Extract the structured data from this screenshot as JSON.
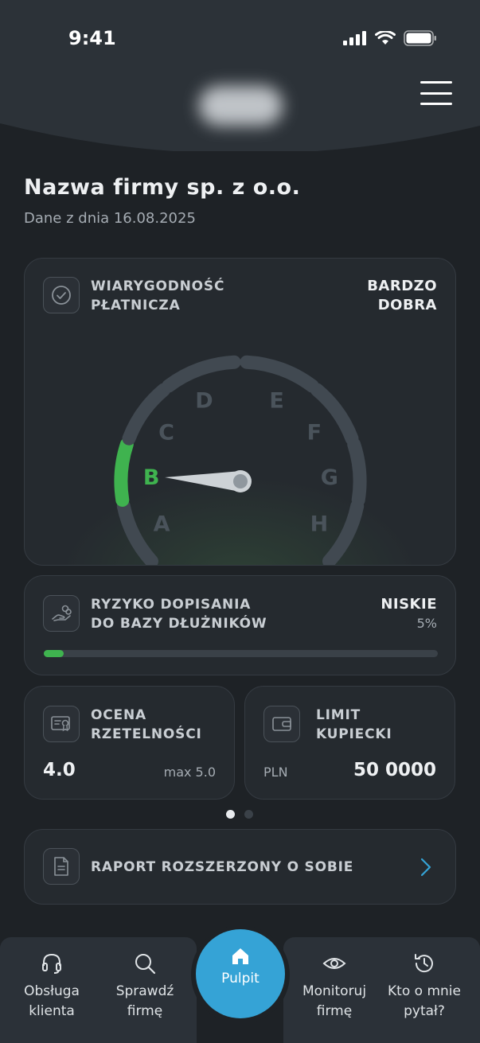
{
  "status_bar": {
    "time": "9:41"
  },
  "header": {
    "menu_icon": "hamburger-menu-icon"
  },
  "company": {
    "name": "Nazwa firmy sp. z o.o.",
    "date_label": "Dane z dnia 16.08.2025"
  },
  "credibility": {
    "title_line1": "WIARYGODNOŚĆ",
    "title_line2": "PŁATNICZA",
    "value_line1": "BARDZO",
    "value_line2": "DOBRA",
    "icon": "check-circle-icon",
    "grades": [
      "A",
      "B",
      "C",
      "D",
      "E",
      "F",
      "G",
      "H"
    ],
    "active_grade": "B",
    "active_color": "#3fb34f"
  },
  "risk": {
    "title_line1": "RYZYKO DOPISANIA",
    "title_line2": "DO BAZY DŁUŻNIKÓW",
    "value": "NISKIE",
    "percent_label": "5%",
    "percent": 5,
    "icon": "hand-coins-icon"
  },
  "rating": {
    "title_line1": "OCENA",
    "title_line2": "RZETELNOŚCI",
    "value": "4.0",
    "max_label": "max 5.0",
    "icon": "certificate-icon"
  },
  "limit": {
    "title_line1": "LIMIT",
    "title_line2": "KUPIECKI",
    "currency": "PLN",
    "value": "50 0000",
    "icon": "wallet-icon"
  },
  "pager": {
    "pages": 2,
    "current": 1
  },
  "report": {
    "label": "RAPORT ROZSZERZONY O SOBIE",
    "icon": "document-icon"
  },
  "tabbar": {
    "support": {
      "line1": "Obsługa",
      "line2": "klienta"
    },
    "check": {
      "line1": "Sprawdź",
      "line2": "firmę"
    },
    "home": {
      "label": "Pulpit"
    },
    "monitor": {
      "line1": "Monitoruj",
      "line2": "firmę"
    },
    "history": {
      "line1": "Kto o mnie",
      "line2": "pytał?"
    }
  },
  "colors": {
    "accent": "#35a3d6",
    "success": "#3fb34f",
    "background": "#1e2226",
    "card": "#252a2f"
  }
}
